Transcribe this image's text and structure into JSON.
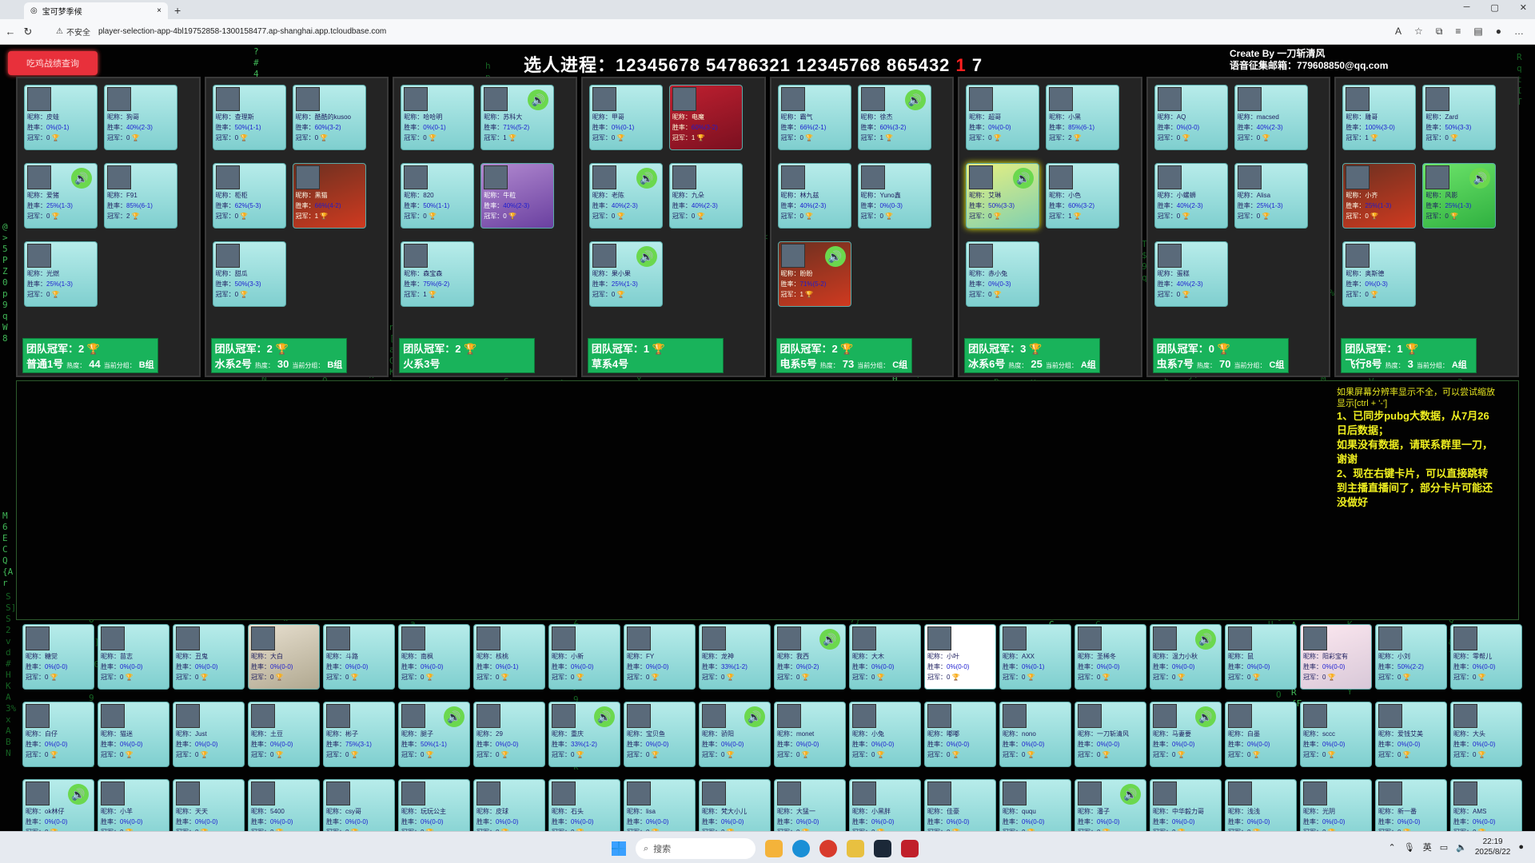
{
  "browser": {
    "tab_title": "宝可梦季候",
    "insecure_label": "不安全",
    "url": "player-selection-app-4bl19752858-1300158477.ap-shanghai.app.tcloudbase.com",
    "new_tab": "+",
    "tab_close": "×"
  },
  "header": {
    "check_button": "吃鸡战绩查询",
    "progress_label": "选人进程：",
    "progress_sequence": "12345678 54786321 12345768 865432 ",
    "progress_current": "1",
    "progress_tail": " 7",
    "credit_line1": "Create By 一刀斩清风",
    "credit_line2": "语音征集邮箱：779608850@qq.com"
  },
  "labels": {
    "nick": "昵称：",
    "rate": "胜率：",
    "champ": "冠军：",
    "trophy": "🏆",
    "team_champ": "团队冠军：",
    "heat": "热度：",
    "score": "当前分组："
  },
  "teams": [
    {
      "champ": "2",
      "name": "普通1号",
      "heat": "44",
      "group": "B组",
      "players": [
        {
          "nick": "皮蛙",
          "rate": "0%(0-1)",
          "champ": "0",
          "style": "",
          "speaker": false
        },
        {
          "nick": "狗哥",
          "rate": "40%(2-3)",
          "champ": "0",
          "style": "",
          "speaker": false
        },
        {
          "nick": "爱猪",
          "rate": "25%(1-3)",
          "champ": "0",
          "style": "",
          "speaker": true
        },
        {
          "nick": "F91",
          "rate": "85%(6-1)",
          "champ": "2",
          "style": "",
          "speaker": false
        },
        {
          "nick": "光燃",
          "rate": "25%(1-3)",
          "champ": "0",
          "style": "",
          "speaker": false
        }
      ]
    },
    {
      "champ": "2",
      "name": "水系2号",
      "heat": "30",
      "group": "B组",
      "players": [
        {
          "nick": "查理斯",
          "rate": "50%(1-1)",
          "champ": "0",
          "style": "",
          "speaker": false
        },
        {
          "nick": "酷酷的kusoo",
          "rate": "60%(3-2)",
          "champ": "0",
          "style": "",
          "speaker": false
        },
        {
          "nick": "柜柜",
          "rate": "62%(5-3)",
          "champ": "0",
          "style": "",
          "speaker": false
        },
        {
          "nick": "黑猫",
          "rate": "66%(4-2)",
          "champ": "1",
          "style": "dark",
          "speaker": false
        },
        {
          "nick": "甜瓜",
          "rate": "50%(3-3)",
          "champ": "0",
          "style": "",
          "speaker": false
        }
      ]
    },
    {
      "champ": "2",
      "name": "火系3号",
      "heat": "",
      "group": "",
      "players": [
        {
          "nick": "哈哈明",
          "rate": "0%(0-1)",
          "champ": "0",
          "style": "",
          "speaker": false
        },
        {
          "nick": "苏科大",
          "rate": "71%(5-2)",
          "champ": "1",
          "style": "",
          "speaker": true
        },
        {
          "nick": "820",
          "rate": "50%(1-1)",
          "champ": "0",
          "style": "",
          "speaker": false
        },
        {
          "nick": "牛粒",
          "rate": "40%(2-3)",
          "champ": "0",
          "style": "purple",
          "speaker": false
        },
        {
          "nick": "森宝森",
          "rate": "75%(6-2)",
          "champ": "1",
          "style": "",
          "speaker": false
        }
      ]
    },
    {
      "champ": "1",
      "name": "草系4号",
      "heat": "",
      "group": "",
      "players": [
        {
          "nick": "甲哥",
          "rate": "0%(0-1)",
          "champ": "0",
          "style": "",
          "speaker": false
        },
        {
          "nick": "电魔",
          "rate": "60%(3-2)",
          "champ": "1",
          "style": "red",
          "speaker": false
        },
        {
          "nick": "老陈",
          "rate": "40%(2-3)",
          "champ": "0",
          "style": "",
          "speaker": true
        },
        {
          "nick": "九朵",
          "rate": "40%(2-3)",
          "champ": "0",
          "style": "",
          "speaker": false
        },
        {
          "nick": "果小果",
          "rate": "25%(1-3)",
          "champ": "0",
          "style": "",
          "speaker": true
        }
      ]
    },
    {
      "champ": "2",
      "name": "电系5号",
      "heat": "73",
      "group": "C组",
      "players": [
        {
          "nick": "霸气",
          "rate": "66%(2-1)",
          "champ": "0",
          "style": "",
          "speaker": false
        },
        {
          "nick": "徐杰",
          "rate": "60%(3-2)",
          "champ": "1",
          "style": "",
          "speaker": true
        },
        {
          "nick": "林九兹",
          "rate": "40%(2-3)",
          "champ": "0",
          "style": "",
          "speaker": false
        },
        {
          "nick": "Yuno鑫",
          "rate": "0%(0-3)",
          "champ": "0",
          "style": "",
          "speaker": false
        },
        {
          "nick": "盼盼",
          "rate": "71%(5-2)",
          "champ": "1",
          "style": "dark",
          "speaker": true
        }
      ]
    },
    {
      "champ": "3",
      "name": "冰系6号",
      "heat": "25",
      "group": "A组",
      "players": [
        {
          "nick": "超哥",
          "rate": "0%(0-0)",
          "champ": "0",
          "style": "",
          "speaker": false
        },
        {
          "nick": "小黑",
          "rate": "85%(6-1)",
          "champ": "2",
          "style": "",
          "speaker": false
        },
        {
          "nick": "艾琳",
          "rate": "50%(3-3)",
          "champ": "0",
          "style": "glow",
          "speaker": true
        },
        {
          "nick": "小色",
          "rate": "60%(3-2)",
          "champ": "1",
          "style": "",
          "speaker": false
        },
        {
          "nick": "赤小兔",
          "rate": "0%(0-3)",
          "champ": "0",
          "style": "",
          "speaker": false
        }
      ]
    },
    {
      "champ": "0",
      "name": "虫系7号",
      "heat": "70",
      "group": "C组",
      "players": [
        {
          "nick": "AQ",
          "rate": "0%(0-0)",
          "champ": "0",
          "style": "",
          "speaker": false
        },
        {
          "nick": "macsed",
          "rate": "40%(2-3)",
          "champ": "0",
          "style": "",
          "speaker": false
        },
        {
          "nick": "小螺蛳",
          "rate": "40%(2-3)",
          "champ": "0",
          "style": "",
          "speaker": false
        },
        {
          "nick": "Alisa",
          "rate": "25%(1-3)",
          "champ": "0",
          "style": "",
          "speaker": false
        },
        {
          "nick": "蛋糕",
          "rate": "40%(2-3)",
          "champ": "0",
          "style": "",
          "speaker": false
        }
      ]
    },
    {
      "champ": "1",
      "name": "飞行8号",
      "heat": "3",
      "group": "A组",
      "players": [
        {
          "nick": "雕哥",
          "rate": "100%(3-0)",
          "champ": "1",
          "style": "",
          "speaker": false
        },
        {
          "nick": "Zard",
          "rate": "50%(3-3)",
          "champ": "0",
          "style": "",
          "speaker": false
        },
        {
          "nick": "小齐",
          "rate": "25%(1-3)",
          "champ": "0",
          "style": "dark",
          "speaker": false
        },
        {
          "nick": "风影",
          "rate": "25%(1-3)",
          "champ": "0",
          "style": "green",
          "speaker": true
        },
        {
          "nick": "奥斯德",
          "rate": "0%(0-3)",
          "champ": "0",
          "style": "",
          "speaker": false
        }
      ]
    }
  ],
  "notice": {
    "line0": "如果屏幕分辨率显示不全，可以尝试缩放显示[ctrl + '-']",
    "line1": "1、已同步pubg大数据，从7月26日后数据；",
    "line2": "如果没有数据，请联系群里一刀，谢谢",
    "line3": "2、现在右键卡片，可以直接跳转到主播直播间了，部分卡片可能还没做好"
  },
  "pool": [
    {
      "nick": "糖觉",
      "rate": "0%(0-0)",
      "champ": "0",
      "speaker": false,
      "style": ""
    },
    {
      "nick": "苗志",
      "rate": "0%(0-0)",
      "champ": "0",
      "speaker": false,
      "style": ""
    },
    {
      "nick": "丑鬼",
      "rate": "0%(0-0)",
      "champ": "0",
      "speaker": false,
      "style": ""
    },
    {
      "nick": "大白",
      "rate": "0%(0-0)",
      "champ": "0",
      "speaker": false,
      "style": "photo"
    },
    {
      "nick": "斗路",
      "rate": "0%(0-0)",
      "champ": "0",
      "speaker": false,
      "style": ""
    },
    {
      "nick": "南枫",
      "rate": "0%(0-0)",
      "champ": "0",
      "speaker": false,
      "style": ""
    },
    {
      "nick": "核桃",
      "rate": "0%(0-1)",
      "champ": "0",
      "speaker": false,
      "style": ""
    },
    {
      "nick": "小新",
      "rate": "0%(0-0)",
      "champ": "0",
      "speaker": false,
      "style": ""
    },
    {
      "nick": "FY",
      "rate": "0%(0-0)",
      "champ": "0",
      "speaker": false,
      "style": ""
    },
    {
      "nick": "龙神",
      "rate": "33%(1-2)",
      "champ": "0",
      "speaker": false,
      "style": ""
    },
    {
      "nick": "我西",
      "rate": "0%(0-2)",
      "champ": "0",
      "speaker": true,
      "style": ""
    },
    {
      "nick": "大木",
      "rate": "0%(0-0)",
      "champ": "0",
      "speaker": false,
      "style": ""
    },
    {
      "nick": "小叶",
      "rate": "0%(0-0)",
      "champ": "0",
      "speaker": false,
      "style": "white"
    },
    {
      "nick": "AXX",
      "rate": "0%(0-1)",
      "champ": "0",
      "speaker": false,
      "style": ""
    },
    {
      "nick": "圣稀冬",
      "rate": "0%(0-0)",
      "champ": "0",
      "speaker": false,
      "style": ""
    },
    {
      "nick": "温力小秋",
      "rate": "0%(0-0)",
      "champ": "0",
      "speaker": true,
      "style": ""
    },
    {
      "nick": "鼠",
      "rate": "0%(0-0)",
      "champ": "0",
      "speaker": false,
      "style": ""
    },
    {
      "nick": "阳彩宝有",
      "rate": "0%(0-0)",
      "champ": "0",
      "speaker": false,
      "style": "pink"
    },
    {
      "nick": "小刘",
      "rate": "50%(2-2)",
      "champ": "0",
      "speaker": false,
      "style": ""
    },
    {
      "nick": "零帮儿",
      "rate": "0%(0-0)",
      "champ": "0",
      "speaker": false,
      "style": ""
    },
    {
      "nick": "白仔",
      "rate": "0%(0-0)",
      "champ": "0",
      "speaker": false,
      "style": ""
    },
    {
      "nick": "猫迷",
      "rate": "0%(0-0)",
      "champ": "0",
      "speaker": false,
      "style": ""
    },
    {
      "nick": "Just",
      "rate": "0%(0-0)",
      "champ": "0",
      "speaker": false,
      "style": ""
    },
    {
      "nick": "土豆",
      "rate": "0%(0-0)",
      "champ": "0",
      "speaker": false,
      "style": ""
    },
    {
      "nick": "彬子",
      "rate": "75%(3-1)",
      "champ": "0",
      "speaker": false,
      "style": ""
    },
    {
      "nick": "腿子",
      "rate": "50%(1-1)",
      "champ": "0",
      "speaker": true,
      "style": ""
    },
    {
      "nick": "29",
      "rate": "0%(0-0)",
      "champ": "0",
      "speaker": false,
      "style": ""
    },
    {
      "nick": "重庆",
      "rate": "33%(1-2)",
      "champ": "0",
      "speaker": true,
      "style": ""
    },
    {
      "nick": "宝贝鱼",
      "rate": "0%(0-0)",
      "champ": "0",
      "speaker": false,
      "style": ""
    },
    {
      "nick": "骄阳",
      "rate": "0%(0-0)",
      "champ": "0",
      "speaker": true,
      "style": ""
    },
    {
      "nick": "monet",
      "rate": "0%(0-0)",
      "champ": "0",
      "speaker": false,
      "style": ""
    },
    {
      "nick": "小兔",
      "rate": "0%(0-0)",
      "champ": "0",
      "speaker": false,
      "style": ""
    },
    {
      "nick": "嘟嘟",
      "rate": "0%(0-0)",
      "champ": "0",
      "speaker": false,
      "style": ""
    },
    {
      "nick": "nono",
      "rate": "0%(0-0)",
      "champ": "0",
      "speaker": false,
      "style": ""
    },
    {
      "nick": "一刀斩清风",
      "rate": "0%(0-0)",
      "champ": "0",
      "speaker": false,
      "style": ""
    },
    {
      "nick": "马妻要",
      "rate": "0%(0-0)",
      "champ": "0",
      "speaker": true,
      "style": ""
    },
    {
      "nick": "白墨",
      "rate": "0%(0-0)",
      "champ": "0",
      "speaker": false,
      "style": ""
    },
    {
      "nick": "sccc",
      "rate": "0%(0-0)",
      "champ": "0",
      "speaker": false,
      "style": ""
    },
    {
      "nick": "爱钱艾美",
      "rate": "0%(0-0)",
      "champ": "0",
      "speaker": false,
      "style": ""
    },
    {
      "nick": "大头",
      "rate": "0%(0-0)",
      "champ": "0",
      "speaker": false,
      "style": ""
    },
    {
      "nick": "ok林仔",
      "rate": "0%(0-0)",
      "champ": "0",
      "speaker": true,
      "style": ""
    },
    {
      "nick": "小羊",
      "rate": "0%(0-0)",
      "champ": "0",
      "speaker": false,
      "style": ""
    },
    {
      "nick": "天天",
      "rate": "0%(0-0)",
      "champ": "0",
      "speaker": false,
      "style": ""
    },
    {
      "nick": "5400",
      "rate": "0%(0-0)",
      "champ": "0",
      "speaker": false,
      "style": ""
    },
    {
      "nick": "csy哥",
      "rate": "0%(0-0)",
      "champ": "0",
      "speaker": false,
      "style": ""
    },
    {
      "nick": "玩玩公主",
      "rate": "0%(0-0)",
      "champ": "0",
      "speaker": false,
      "style": ""
    },
    {
      "nick": "皮球",
      "rate": "0%(0-0)",
      "champ": "0",
      "speaker": false,
      "style": ""
    },
    {
      "nick": "石头",
      "rate": "0%(0-0)",
      "champ": "0",
      "speaker": false,
      "style": ""
    },
    {
      "nick": "lisa",
      "rate": "0%(0-0)",
      "champ": "0",
      "speaker": false,
      "style": ""
    },
    {
      "nick": "梵大小儿",
      "rate": "0%(0-0)",
      "champ": "0",
      "speaker": false,
      "style": ""
    },
    {
      "nick": "大猛一",
      "rate": "0%(0-0)",
      "champ": "0",
      "speaker": false,
      "style": ""
    },
    {
      "nick": "小黑胖",
      "rate": "0%(0-0)",
      "champ": "0",
      "speaker": false,
      "style": ""
    },
    {
      "nick": "佳豪",
      "rate": "0%(0-0)",
      "champ": "0",
      "speaker": false,
      "style": ""
    },
    {
      "nick": "ququ",
      "rate": "0%(0-0)",
      "champ": "0",
      "speaker": false,
      "style": ""
    },
    {
      "nick": "潘子",
      "rate": "0%(0-0)",
      "champ": "0",
      "speaker": true,
      "style": ""
    },
    {
      "nick": "中华毅力哥",
      "rate": "0%(0-0)",
      "champ": "0",
      "speaker": false,
      "style": ""
    },
    {
      "nick": "浅浅",
      "rate": "0%(0-0)",
      "champ": "0",
      "speaker": false,
      "style": ""
    },
    {
      "nick": "光阴",
      "rate": "0%(0-0)",
      "champ": "0",
      "speaker": false,
      "style": ""
    },
    {
      "nick": "新一番",
      "rate": "0%(0-0)",
      "champ": "0",
      "speaker": false,
      "style": ""
    },
    {
      "nick": "AMS",
      "rate": "0%(0-0)",
      "champ": "0",
      "speaker": false,
      "style": ""
    }
  ],
  "taskbar": {
    "search": "搜索",
    "ime": "英",
    "time": "22:19",
    "date": "2025/8/22"
  },
  "colors": {
    "accent": "#19b35b",
    "card": "#9fe0df",
    "danger": "#e8303b",
    "matrix": "#1a7a2a"
  }
}
